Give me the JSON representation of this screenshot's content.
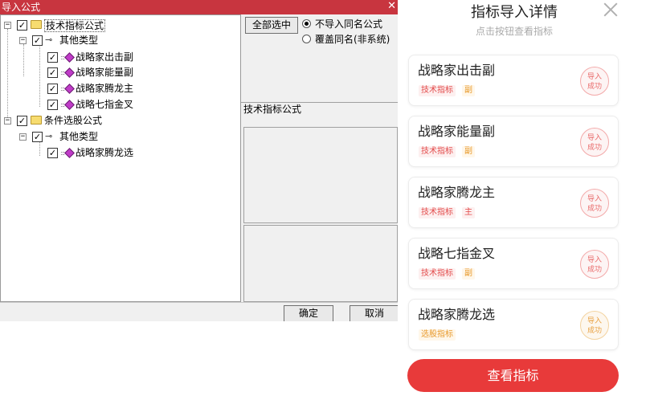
{
  "dialog": {
    "title": "导入公式",
    "close_glyph": "✕",
    "tree": [
      {
        "label": "技术指标公式",
        "checked": "✓",
        "expand": "−"
      },
      {
        "label": "其他类型",
        "checked": "✓",
        "expand": "−"
      },
      {
        "label": "战略家出击副",
        "checked": "✓"
      },
      {
        "label": "战略家能量副",
        "checked": "✓"
      },
      {
        "label": "战略家腾龙主",
        "checked": "✓"
      },
      {
        "label": "战略七指金叉",
        "checked": "✓"
      },
      {
        "label": "条件选股公式",
        "checked": "✓",
        "expand": "−"
      },
      {
        "label": "其他类型",
        "checked": "✓",
        "expand": "−"
      },
      {
        "label": "战略家腾龙选",
        "checked": "✓"
      }
    ],
    "select_all_label": "全部选中",
    "radio_options": [
      {
        "label": "不导入同名公式",
        "selected": true
      },
      {
        "label": "覆盖同名(非系统)",
        "selected": false
      }
    ],
    "section_label": "技术指标公式",
    "ok_label": "确定",
    "cancel_label": "取消"
  },
  "panel": {
    "title": "指标导入详情",
    "subtitle": "点击按钮查看指标",
    "items": [
      {
        "name": "战略家出击副",
        "tags": [
          "技术指标",
          "副"
        ],
        "status": [
          "导入",
          "成功"
        ]
      },
      {
        "name": "战略家能量副",
        "tags": [
          "技术指标",
          "副"
        ],
        "status": [
          "导入",
          "成功"
        ]
      },
      {
        "name": "战略家腾龙主",
        "tags": [
          "技术指标",
          "主"
        ],
        "status": [
          "导入",
          "成功"
        ]
      },
      {
        "name": "战略七指金叉",
        "tags": [
          "技术指标",
          "副"
        ],
        "status": [
          "导入",
          "成功"
        ]
      },
      {
        "name": "战略家腾龙选",
        "tags": [
          "选股指标"
        ],
        "status": [
          "导入",
          "成功"
        ]
      }
    ],
    "view_button": "查看指标"
  },
  "colors": {
    "titlebar": "#c8353f",
    "accent_red": "#e83a3a",
    "tag_red": "#e34b4b",
    "tag_orange": "#e89a2c"
  }
}
